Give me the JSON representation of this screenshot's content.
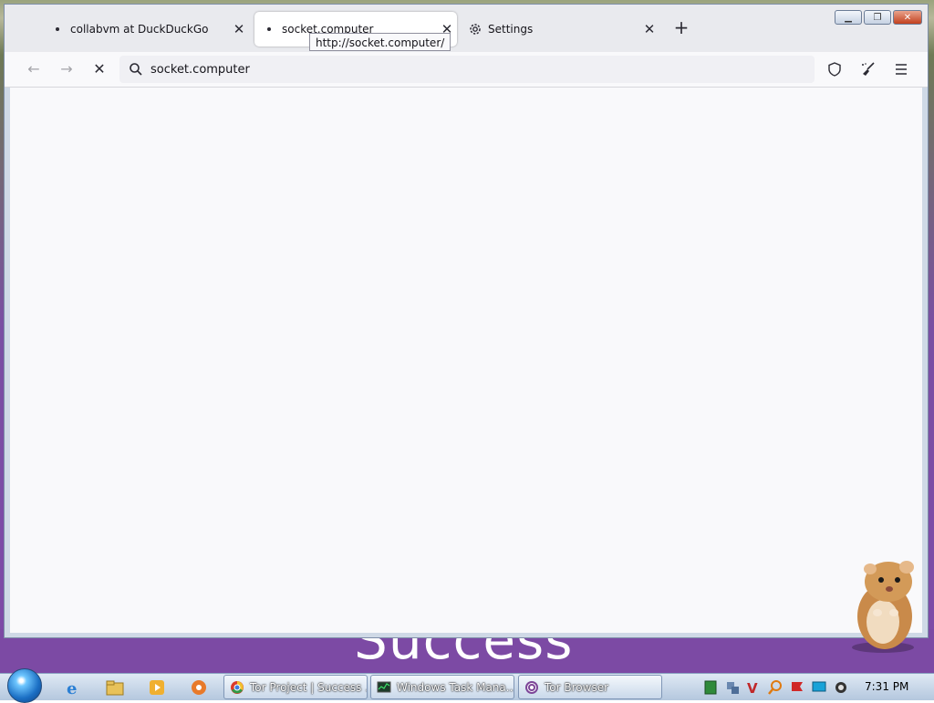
{
  "tabs": [
    {
      "label": "collabvm at DuckDuckGo",
      "active": false
    },
    {
      "label": "socket.computer",
      "active": true
    },
    {
      "label": "Settings",
      "active": false
    }
  ],
  "tooltip": "http://socket.computer/",
  "urlbar": {
    "value": "socket.computer"
  },
  "background_text": "Success",
  "taskbar": {
    "items": [
      {
        "label": "Tor Project | Success ..."
      },
      {
        "label": "Windows Task Mana..."
      },
      {
        "label": "Tor Browser"
      }
    ],
    "clock": "7:31 PM"
  },
  "colors": {
    "accent": "#7c4aa4",
    "chrome_bg": "#e9eaee",
    "content_bg": "#f9f9fb"
  }
}
